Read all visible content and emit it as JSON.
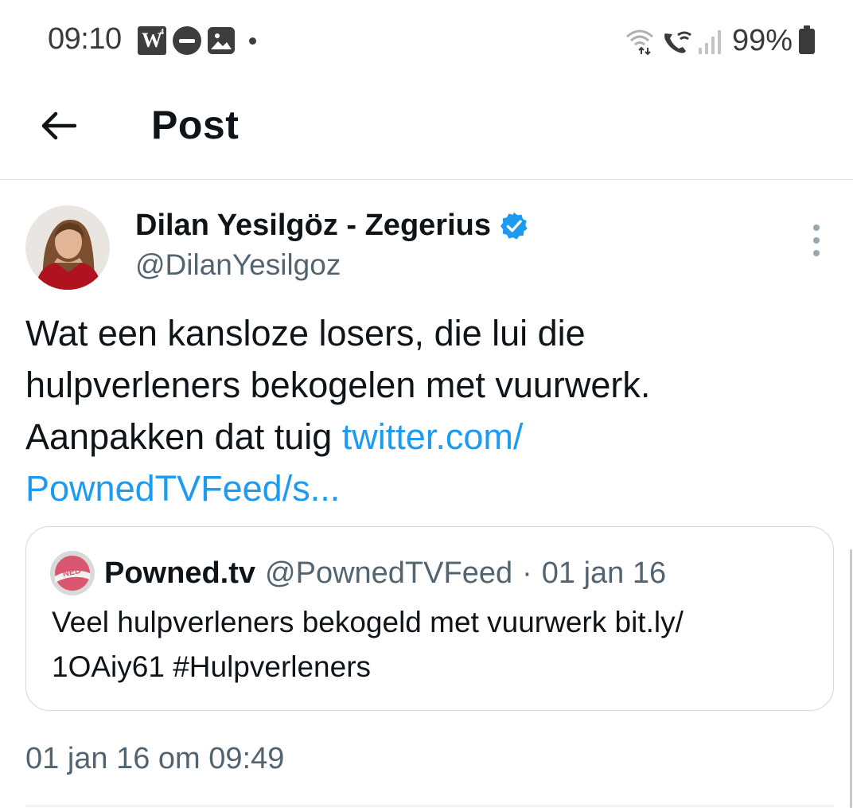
{
  "status_bar": {
    "time": "09:10",
    "w_badge_letter": "W",
    "w_badge_superscript": "4",
    "battery_percent": "99%",
    "icons": [
      "w-app-icon",
      "do-not-disturb-icon",
      "image-icon",
      "notification-dot-icon",
      "wifi-data-icon",
      "wifi-calling-icon",
      "signal-icon",
      "battery-icon"
    ]
  },
  "header": {
    "back_icon": "arrow-left-icon",
    "title": "Post"
  },
  "tweet": {
    "author_name": "Dilan Yesilgöz - Zegerius",
    "author_handle": "@DilanYesilgoz",
    "verified": true,
    "text_lines": [
      "Wat een kansloze losers, die lui die",
      "hulpverleners bekogelen met vuurwerk."
    ],
    "text_line3_prefix": "Aanpakken dat tuig ",
    "link_line1": "twitter.com/",
    "link_line2": "PownedTVFeed/s...",
    "timestamp": "01 jan 16 om 09:49"
  },
  "quote": {
    "name": "Powned.tv",
    "handle": "@PownedTVFeed",
    "separator": "·",
    "date": "01 jan 16",
    "avatar_label": "NED",
    "text_lines": [
      "Veel hulpverleners bekogeld met vuurwerk bit.ly/",
      "1OAiy61 #Hulpverleners"
    ]
  },
  "colors": {
    "link": "#1d9bf0",
    "secondary_text": "#536471",
    "verified_badge": "#1d9bf0",
    "border": "#cfd9de"
  }
}
